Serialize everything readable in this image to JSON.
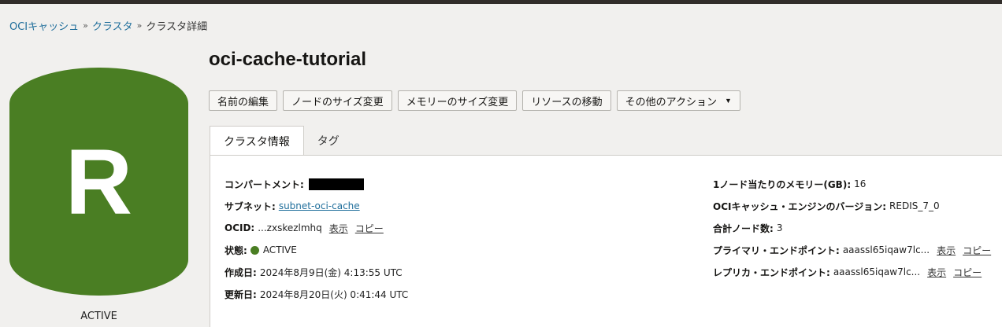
{
  "breadcrumb": {
    "items": [
      "OCIキャッシュ",
      "クラスタ"
    ],
    "separator": "»",
    "current": "クラスタ詳細"
  },
  "badge": {
    "letter": "R",
    "status": "ACTIVE",
    "color": "#4a7e23"
  },
  "title": "oci-cache-tutorial",
  "actions": {
    "edit_name": "名前の編集",
    "resize_nodes": "ノードのサイズ変更",
    "resize_memory": "メモリーのサイズ変更",
    "move_resource": "リソースの移動",
    "more_actions": "その他のアクション"
  },
  "tabs": {
    "info": "クラスタ情報",
    "tags": "タグ"
  },
  "details": {
    "compartment": {
      "label": "コンパートメント:"
    },
    "subnet": {
      "label": "サブネット:",
      "value": "subnet-oci-cache"
    },
    "ocid": {
      "label": "OCID:",
      "value": "...zxskezlmhq",
      "show": "表示",
      "copy": "コピー"
    },
    "state": {
      "label": "状態:",
      "value": "ACTIVE"
    },
    "created": {
      "label": "作成日:",
      "value": "2024年8月9日(金) 4:13:55 UTC"
    },
    "updated": {
      "label": "更新日:",
      "value": "2024年8月20日(火) 0:41:44 UTC"
    },
    "memory": {
      "label": "1ノード当たりのメモリー(GB):",
      "value": "16"
    },
    "engine": {
      "label": "OCIキャッシュ・エンジンのバージョン:",
      "value": "REDIS_7_0"
    },
    "nodes": {
      "label": "合計ノード数:",
      "value": "3"
    },
    "primary_endpoint": {
      "label": "プライマリ・エンドポイント:",
      "value": "aaassl65iqaw7lc...",
      "show": "表示",
      "copy": "コピー"
    },
    "replica_endpoint": {
      "label": "レプリカ・エンドポイント:",
      "value": "aaassl65iqaw7lc...",
      "show": "表示",
      "copy": "コピー"
    }
  }
}
